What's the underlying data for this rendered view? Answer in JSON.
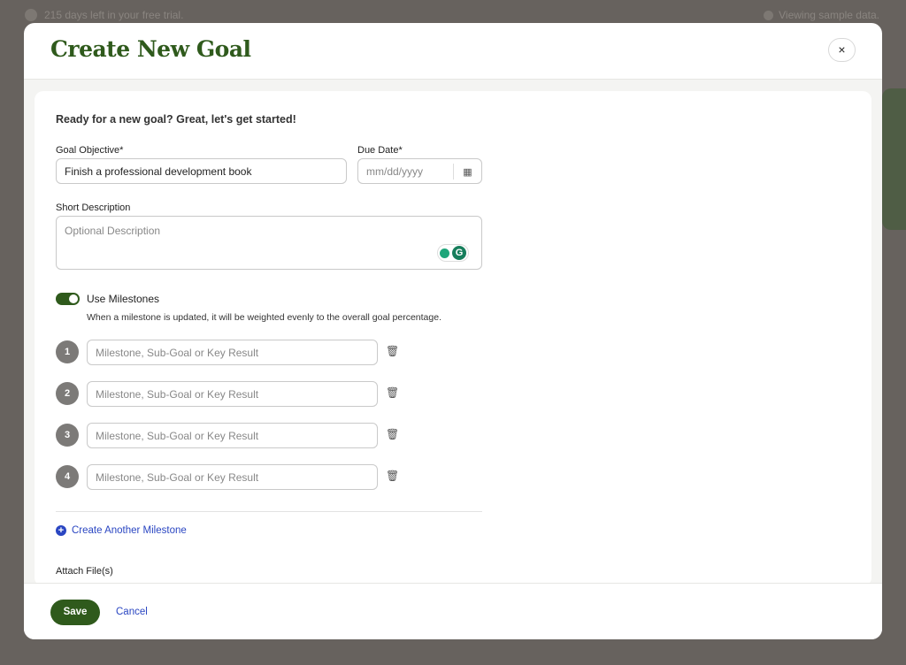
{
  "background": {
    "trial_text": "215 days left in your free trial.",
    "sample_text": "Viewing sample data."
  },
  "modal": {
    "title": "Create New Goal",
    "close_label": "×",
    "intro": "Ready for a new goal? Great, let's get started!",
    "goal_objective": {
      "label": "Goal Objective*",
      "value": "Finish a professional development book"
    },
    "due_date": {
      "label": "Due Date*",
      "placeholder": "mm/dd/yyyy"
    },
    "short_description": {
      "label": "Short Description",
      "placeholder": "Optional Description"
    },
    "milestones": {
      "toggle_label": "Use Milestones",
      "enabled": true,
      "note": "When a milestone is updated, it will be weighted evenly to the overall goal percentage.",
      "items": [
        {
          "number": "1",
          "placeholder": "Milestone, Sub-Goal or Key Result"
        },
        {
          "number": "2",
          "placeholder": "Milestone, Sub-Goal or Key Result"
        },
        {
          "number": "3",
          "placeholder": "Milestone, Sub-Goal or Key Result"
        },
        {
          "number": "4",
          "placeholder": "Milestone, Sub-Goal or Key Result"
        }
      ],
      "create_label": "Create Another Milestone"
    },
    "attach_label": "Attach File(s)",
    "save_label": "Save",
    "cancel_label": "Cancel"
  },
  "colors": {
    "brand_green": "#2f5a1c",
    "link_blue": "#2a46c2"
  }
}
